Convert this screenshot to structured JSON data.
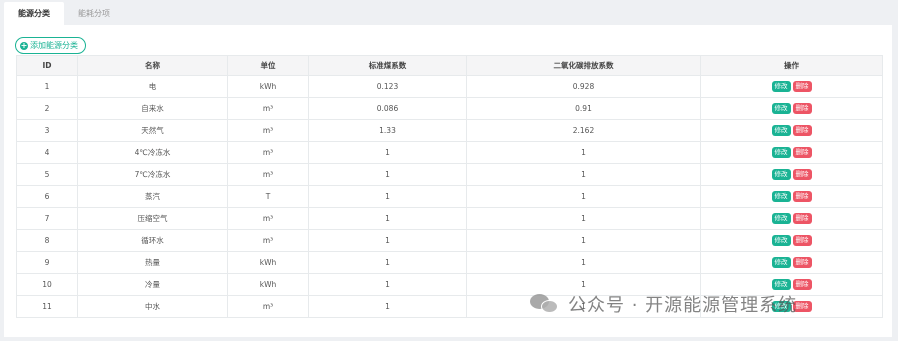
{
  "tabs": [
    {
      "label": "能源分类"
    },
    {
      "label": "能耗分项"
    }
  ],
  "add_button": {
    "label": "添加能源分类"
  },
  "table": {
    "headers": [
      "ID",
      "名称",
      "单位",
      "标准煤系数",
      "二氧化碳排放系数",
      "操作"
    ],
    "rows": [
      {
        "id": "1",
        "name": "电",
        "unit": "kWh",
        "coal": "0.123",
        "co2": "0.928"
      },
      {
        "id": "2",
        "name": "自来水",
        "unit": "m³",
        "coal": "0.086",
        "co2": "0.91"
      },
      {
        "id": "3",
        "name": "天然气",
        "unit": "m³",
        "coal": "1.33",
        "co2": "2.162"
      },
      {
        "id": "4",
        "name": "4℃冷冻水",
        "unit": "m³",
        "coal": "1",
        "co2": "1"
      },
      {
        "id": "5",
        "name": "7℃冷冻水",
        "unit": "m³",
        "coal": "1",
        "co2": "1"
      },
      {
        "id": "6",
        "name": "蒸汽",
        "unit": "T",
        "coal": "1",
        "co2": "1"
      },
      {
        "id": "7",
        "name": "压缩空气",
        "unit": "m³",
        "coal": "1",
        "co2": "1"
      },
      {
        "id": "8",
        "name": "循环水",
        "unit": "m³",
        "coal": "1",
        "co2": "1"
      },
      {
        "id": "9",
        "name": "热量",
        "unit": "kWh",
        "coal": "1",
        "co2": "1"
      },
      {
        "id": "10",
        "name": "冷量",
        "unit": "kWh",
        "coal": "1",
        "co2": "1"
      },
      {
        "id": "11",
        "name": "中水",
        "unit": "m³",
        "coal": "1",
        "co2": "1"
      }
    ],
    "edit_label": "修改",
    "delete_label": "删除"
  },
  "watermark": {
    "text": "公众号 · 开源能源管理系统",
    "icon": "wechat-icon"
  },
  "colors": {
    "accent": "#1ab394",
    "danger": "#ed5565"
  }
}
